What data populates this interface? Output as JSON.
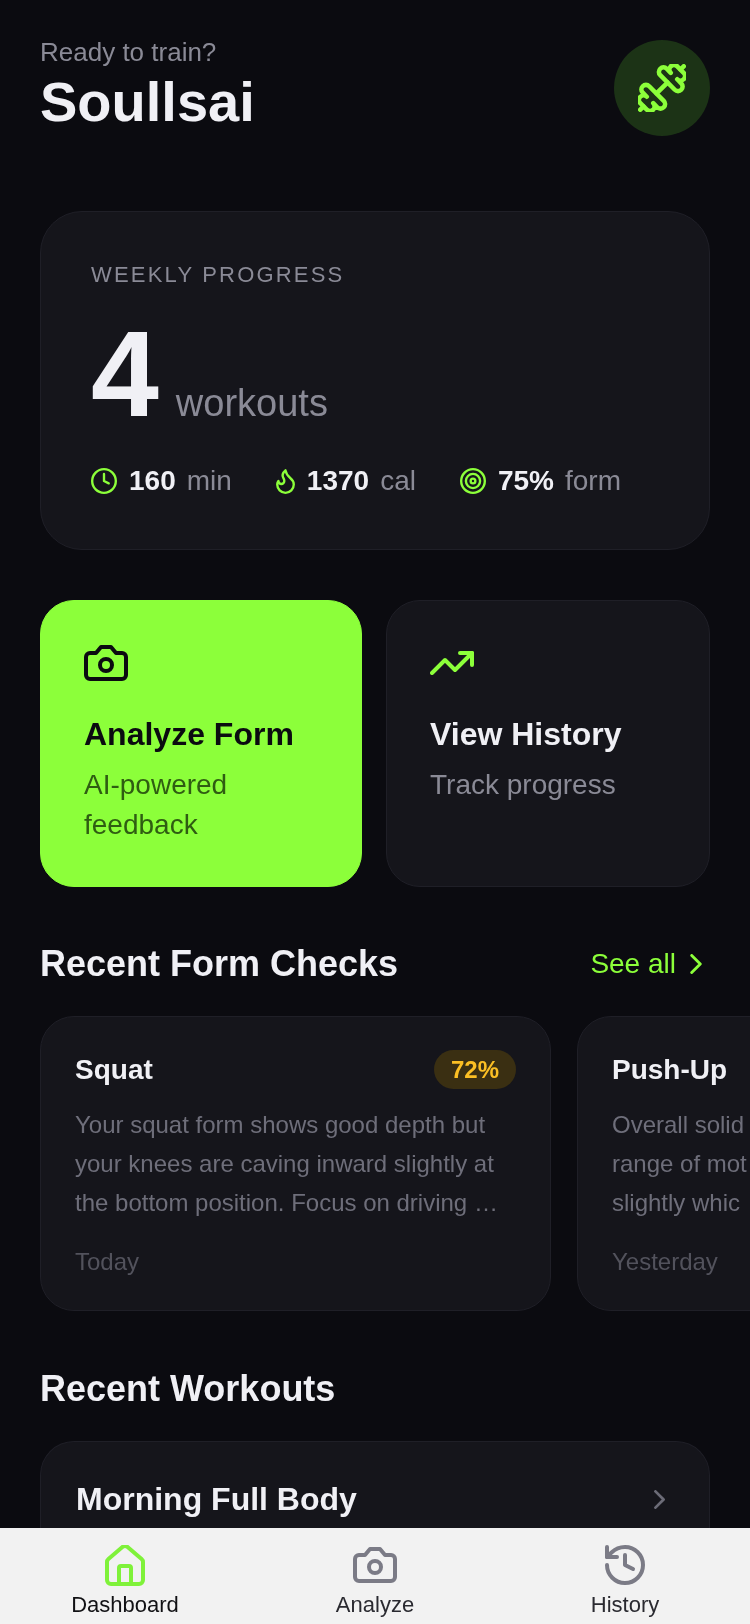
{
  "header": {
    "greeting": "Ready to train?",
    "name": "Soullsai"
  },
  "weekly_progress": {
    "title": "WEEKLY PROGRESS",
    "count": "4",
    "count_label": "workouts",
    "stats": [
      {
        "value": "160",
        "unit": "min"
      },
      {
        "value": "1370",
        "unit": "cal"
      },
      {
        "value": "75%",
        "unit": "form"
      }
    ]
  },
  "actions": [
    {
      "title": "Analyze Form",
      "subtitle": "AI-powered feedback",
      "highlighted": true
    },
    {
      "title": "View History",
      "subtitle": "Track progress",
      "highlighted": false
    }
  ],
  "form_checks": {
    "title": "Recent Form Checks",
    "link": "See all",
    "items": [
      {
        "exercise": "Squat",
        "score": "72%",
        "summary": "Your squat form shows good depth but your knees are caving inward slightly at the bottom position. Focus on driving …",
        "date": "Today"
      },
      {
        "exercise": "Push-Up",
        "summary": "Overall solid range of mot slightly whic",
        "date": "Yesterday"
      }
    ]
  },
  "recent_workouts": {
    "title": "Recent Workouts",
    "items": [
      {
        "name": "Morning Full Body"
      }
    ]
  },
  "nav": {
    "tabs": [
      {
        "label": "Dashboard",
        "selected": true
      },
      {
        "label": "Analyze",
        "selected": false
      },
      {
        "label": "History",
        "selected": false
      }
    ]
  }
}
